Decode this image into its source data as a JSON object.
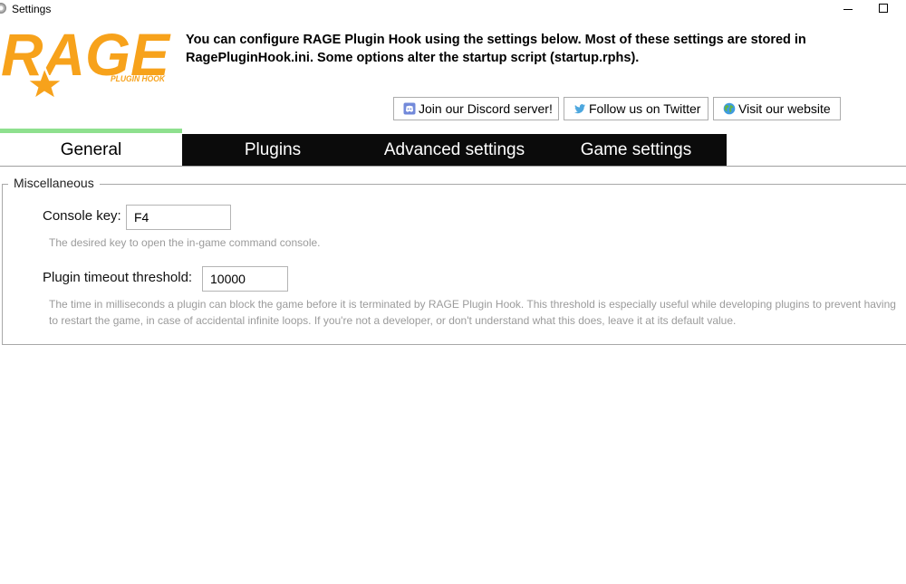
{
  "window": {
    "title": "Settings"
  },
  "header": {
    "logo_text": "RAGE",
    "logo_subtext": "PLUGIN HOOK",
    "description": "You can configure RAGE Plugin Hook using the settings below. Most of these settings are stored in RagePluginHook.ini. Some options alter the startup script (startup.rphs)."
  },
  "social": {
    "discord_label": "Join our Discord server!",
    "twitter_label": "Follow us on Twitter",
    "website_label": "Visit our website"
  },
  "tabs": [
    {
      "label": "General",
      "active": true
    },
    {
      "label": "Plugins",
      "active": false
    },
    {
      "label": "Advanced settings",
      "active": false
    },
    {
      "label": "Game settings",
      "active": false
    }
  ],
  "general": {
    "group_title": "Miscellaneous",
    "console_key": {
      "label": "Console key:",
      "value": "F4",
      "hint": "The desired key to open the in-game command console."
    },
    "plugin_timeout": {
      "label": "Plugin timeout threshold:",
      "value": "10000",
      "hint": "The time in milliseconds a plugin can block the game before it is terminated by RAGE Plugin Hook. This threshold is especially useful while developing plugins to prevent having to restart the game, in case of accidental infinite loops. If you're not a developer, or don't understand what this does, leave it at its default value."
    }
  },
  "colors": {
    "logo_orange": "#f7a21b",
    "active_tab_accent": "#8ee08e",
    "inactive_tab_bg": "#0b0b0b",
    "hint_text": "#9b9b9b"
  }
}
